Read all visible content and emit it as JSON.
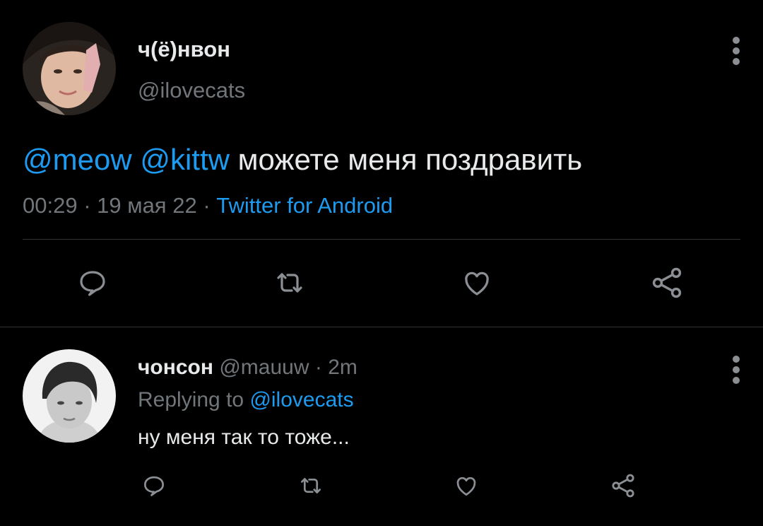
{
  "main_tweet": {
    "author_name": "ч(ё)нвон",
    "author_handle": "@ilovecats",
    "mention_1": "@meow",
    "mention_2": "@kittw",
    "text": "можете меня поздравить",
    "time": "00:29",
    "date": "19 мая 22",
    "separator": "·",
    "source": "Twitter for Android"
  },
  "reply": {
    "author_name": "чонсон",
    "author_handle": "@mauuw",
    "separator": "·",
    "time_ago": "2m",
    "replying_label": "Replying to",
    "replying_handle": "@ilovecats",
    "text": "ну меня так то тоже..."
  },
  "icons": {
    "reply": "speech-bubble-icon",
    "retweet": "retweet-icon",
    "like": "heart-icon",
    "share": "share-icon",
    "more": "vertical-kebab-icon"
  },
  "colors": {
    "background": "#000000",
    "text": "#e7e9ea",
    "muted": "#71767b",
    "accent": "#1d9bf0",
    "divider": "#2f3336"
  }
}
